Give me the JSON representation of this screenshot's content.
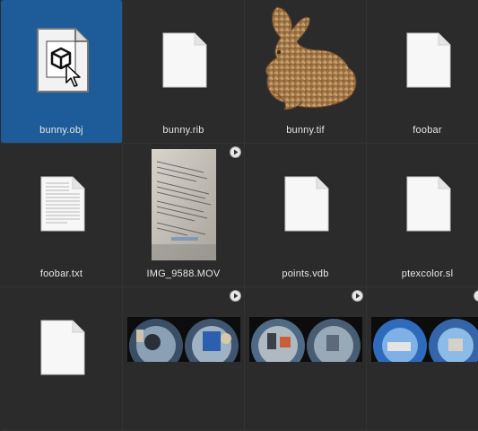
{
  "files": [
    {
      "name": "bunny.obj",
      "icon": "obj-file-icon",
      "selected": true
    },
    {
      "name": "bunny.rib",
      "icon": "blank-document-icon"
    },
    {
      "name": "bunny.tif",
      "icon": "bunny-image-thumbnail"
    },
    {
      "name": "foobar",
      "icon": "blank-document-icon"
    },
    {
      "name": "foobar.txt",
      "icon": "text-document-icon"
    },
    {
      "name": "IMG_9588.MOV",
      "icon": "video-thumbnail",
      "has_play": true
    },
    {
      "name": "points.vdb",
      "icon": "blank-document-icon"
    },
    {
      "name": "ptexcolor.sl",
      "icon": "blank-document-icon"
    },
    {
      "name": "",
      "icon": "blank-document-icon"
    },
    {
      "name": "",
      "icon": "fisheye-thumbnail",
      "has_play": true
    },
    {
      "name": "",
      "icon": "fisheye-thumbnail",
      "has_play": true
    },
    {
      "name": "",
      "icon": "fisheye-thumbnail",
      "has_play": true
    }
  ],
  "colors": {
    "background": "#2b2b2b",
    "selection": "#1d5c98",
    "label": "#e6e6e6"
  }
}
